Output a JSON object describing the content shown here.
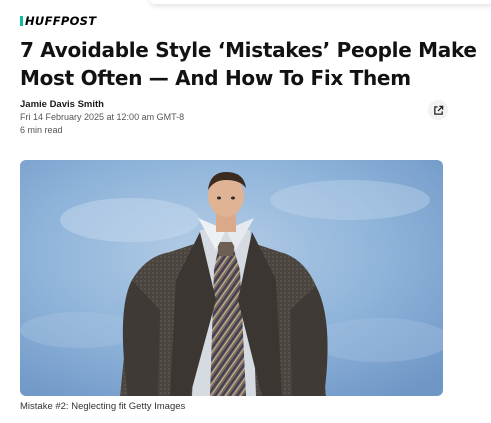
{
  "brand": {
    "name": "HUFFPOST",
    "accent": "#0dbe98"
  },
  "article": {
    "headline": "7 Avoidable Style ‘Mistakes’ People Make Most Often — And How To Fix Them",
    "author": "Jamie Davis Smith",
    "date": "Fri 14 February 2025 at 12:00 am GMT-8",
    "read_time": "6 min read",
    "share_icon": "external-link-icon"
  },
  "image": {
    "caption": "Mistake #2: Neglecting fit Getty Images",
    "sky_color": "#8fb4da"
  }
}
